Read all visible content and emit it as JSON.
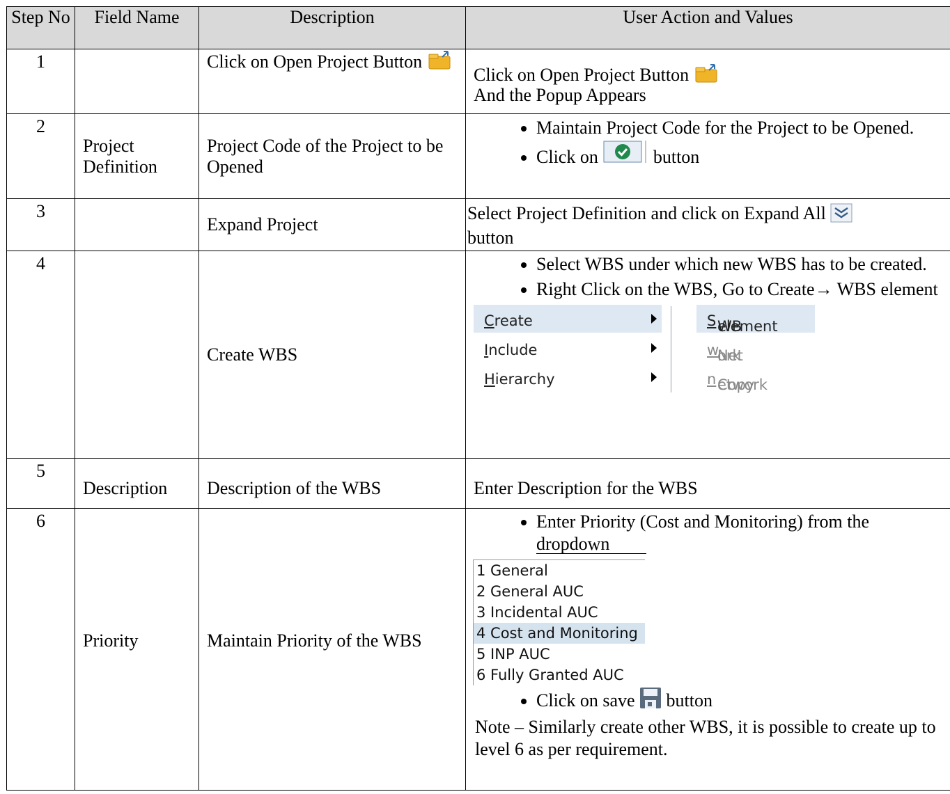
{
  "headers": {
    "step": "Step No",
    "field": "Field Name",
    "description": "Description",
    "action": "User Action and Values"
  },
  "rows": [
    {
      "step": "1",
      "field": "",
      "description": "Click on Open Project Button",
      "action_line1": "Click on Open Project Button",
      "action_line2": "And the Popup Appears"
    },
    {
      "step": "2",
      "field": "Project Definition",
      "description": "Project Code of the Project to be Opened",
      "bullet1": "Maintain Project Code for the Project to be Opened.",
      "bullet2_pre": "Click on",
      "bullet2_post": "button"
    },
    {
      "step": "3",
      "field": "",
      "description": "Expand Project",
      "action_text": "Select Project Definition and click on Expand All",
      "action_post": "button"
    },
    {
      "step": "4",
      "field": "",
      "description": "Create WBS",
      "bullet1": "Select WBS under which new WBS has to be created.",
      "bullet2": "Right Click on the WBS, Go to Create→ WBS element",
      "menu": {
        "items": [
          {
            "pre": "",
            "mnemonic": "C",
            "post": "reate"
          },
          {
            "pre": "",
            "mnemonic": "I",
            "post": "nclude"
          },
          {
            "pre": "",
            "mnemonic": "H",
            "post": "ierarchy"
          }
        ],
        "submenu": [
          {
            "pre": "WB",
            "mnemonic": "S",
            "post": " element"
          },
          {
            "pre": "Net",
            "mnemonic": "w",
            "post": "ork"
          },
          {
            "pre": "Copy ",
            "mnemonic": "n",
            "post": "etwork"
          }
        ]
      }
    },
    {
      "step": "5",
      "field": "Description",
      "description": "Description of the WBS",
      "action_text": "Enter Description for the WBS"
    },
    {
      "step": "6",
      "field": "Priority",
      "description": "Maintain Priority of the WBS",
      "bullet1": "Enter Priority (Cost and Monitoring) from the dropdown",
      "dropdown": [
        "1 General",
        "2 General AUC",
        "3 Incidental AUC",
        "4 Cost and Monitoring",
        "5 INP AUC",
        "6 Fully Granted AUC"
      ],
      "dropdown_selected": 3,
      "bullet2_pre": "Click on save",
      "bullet2_post": "button",
      "note": "Note – Similarly create other WBS, it is possible to create up to level 6 as per requirement."
    }
  ]
}
